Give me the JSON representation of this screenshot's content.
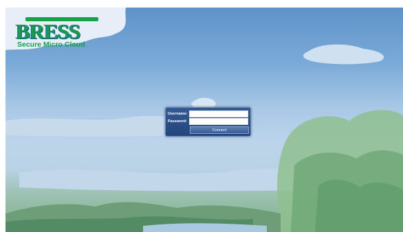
{
  "brand": {
    "name": "BRESS",
    "tagline": "Secure Micro Cloud",
    "logo_color": "#1a9b47"
  },
  "login": {
    "username_label": "Username:",
    "password_label": "Password:",
    "username_value": "",
    "password_value": "",
    "connect_label": "Connect"
  },
  "colors": {
    "panel_bg": "#2a4c85",
    "sky_top": "#5f93c9",
    "foliage": "#7fae88"
  }
}
